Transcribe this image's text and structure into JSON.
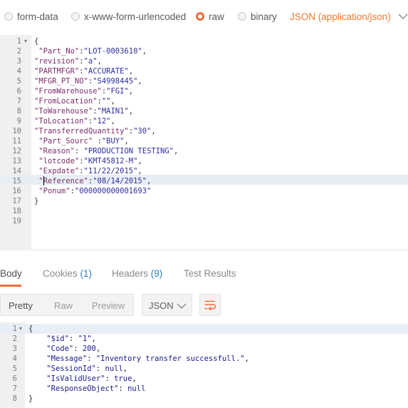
{
  "body_type": {
    "options": [
      "form-data",
      "x-www-form-urlencoded",
      "raw",
      "binary"
    ],
    "selected": "raw",
    "content_type": "JSON (application/json)"
  },
  "request_editor": {
    "line_numbers": [
      "1",
      "2",
      "3",
      "4",
      "5",
      "6",
      "7",
      "8",
      "9",
      "10",
      "11",
      "12",
      "13",
      "14",
      "15",
      "16",
      "17",
      "18",
      "19"
    ],
    "active_line": 15,
    "lines": [
      {
        "key": "",
        "value": "",
        "text": "{"
      },
      {
        "key": " \"Part_No\"",
        "sep": ":",
        "value": "\"LOT-0003610\"",
        "tail": ","
      },
      {
        "key": "\"revision\"",
        "sep": ":",
        "value": "\"a\"",
        "tail": ","
      },
      {
        "key": "\"PARTMFGR\"",
        "sep": ":",
        "value": "\"ACCURATE\"",
        "tail": ","
      },
      {
        "key": "\"MFGR_PT_NO\"",
        "sep": ":",
        "value": "\"S4998445\"",
        "tail": ","
      },
      {
        "key": "\"FromWarehouse\"",
        "sep": ":",
        "value": "\"FGI\"",
        "tail": ","
      },
      {
        "key": "\"FromLocation\"",
        "sep": ":",
        "value": "\"\"",
        "tail": ","
      },
      {
        "key": "\"ToWarehouse\"",
        "sep": ":",
        "value": "\"MAIN1\"",
        "tail": ","
      },
      {
        "key": "\"ToLocation\"",
        "sep": ":",
        "value": "\"12\"",
        "tail": ","
      },
      {
        "key": "\"TransferredQuantity\"",
        "sep": ":",
        "value": "\"30\"",
        "tail": ","
      },
      {
        "key": " \"Part_Sourc\"",
        "sep": " :",
        "value": "\"BUY\"",
        "tail": ","
      },
      {
        "key": " \"Reason\"",
        "sep": ": ",
        "value": "\"PRODUCTION TESTING\"",
        "tail": ","
      },
      {
        "key": " \"lotcode\"",
        "sep": ":",
        "value": "\"KMT45812-M\"",
        "tail": ","
      },
      {
        "key": " \"Expdate\"",
        "sep": ":",
        "value": "\"11/22/2015\"",
        "tail": ","
      },
      {
        "key": " \"Reference\"",
        "sep": ":",
        "value": "\"08/14/2015\"",
        "tail": ","
      },
      {
        "key": " \"Ponum\"",
        "sep": ":",
        "value": "\"000000000001693\"",
        "tail": ""
      },
      {
        "key": "",
        "value": "",
        "text": "}"
      },
      {
        "key": "",
        "value": "",
        "text": ""
      },
      {
        "key": "",
        "value": "",
        "text": ""
      }
    ]
  },
  "response_tabs": {
    "body": "Body",
    "cookies": "Cookies",
    "cookies_count": "(1)",
    "headers": "Headers",
    "headers_count": "(9)",
    "test_results": "Test Results"
  },
  "view_toolbar": {
    "pretty": "Pretty",
    "raw": "Raw",
    "preview": "Preview",
    "language": "JSON"
  },
  "response_editor": {
    "line_numbers": [
      "1",
      "2",
      "3",
      "4",
      "5",
      "6",
      "7",
      "8"
    ],
    "lines": [
      {
        "indent": "",
        "key": "",
        "sep": "",
        "value": "",
        "tail": "",
        "text": "{"
      },
      {
        "indent": "    ",
        "key": "\"$id\"",
        "sep": ": ",
        "value": "\"1\"",
        "tail": ","
      },
      {
        "indent": "    ",
        "key": "\"Code\"",
        "sep": ": ",
        "value": "200",
        "tail": ","
      },
      {
        "indent": "    ",
        "key": "\"Message\"",
        "sep": ": ",
        "value": "\"Inventory transfer successfull.\"",
        "tail": ","
      },
      {
        "indent": "    ",
        "key": "\"SessionId\"",
        "sep": ": ",
        "value": "null",
        "tail": ","
      },
      {
        "indent": "    ",
        "key": "\"IsValidUser\"",
        "sep": ": ",
        "value": "true",
        "tail": ","
      },
      {
        "indent": "    ",
        "key": "\"ResponseObject\"",
        "sep": ": ",
        "value": "null",
        "tail": ""
      },
      {
        "indent": "",
        "key": "",
        "sep": "",
        "value": "",
        "tail": "",
        "text": "}"
      }
    ]
  },
  "colors": {
    "accent": "#f26b3a",
    "content_type": "#f07a2c",
    "count": "#2c7fc6"
  }
}
